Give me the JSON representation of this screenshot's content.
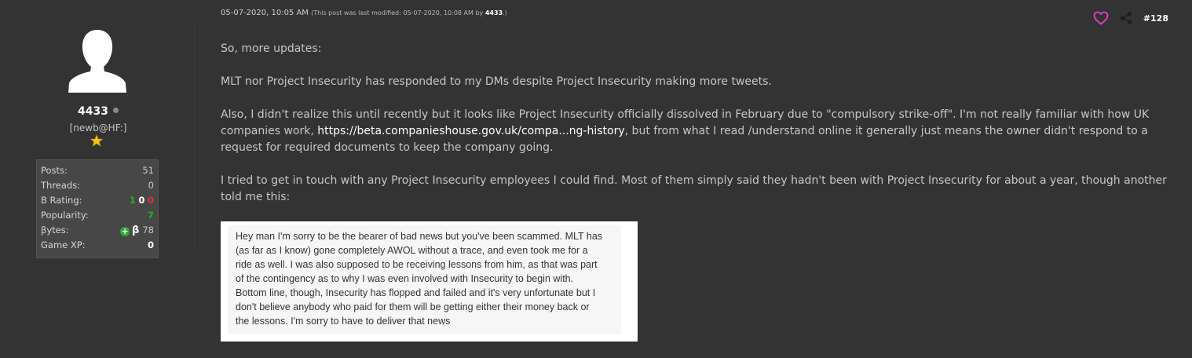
{
  "user": {
    "name": "4433",
    "title": "[newb@HF:]",
    "stats": [
      {
        "label": "Posts:",
        "value": "51"
      },
      {
        "label": "Threads:",
        "value": "0"
      },
      {
        "label": "B Rating:",
        "values": [
          "1",
          "0",
          "0"
        ]
      },
      {
        "label": "Popularity:",
        "value": "7"
      },
      {
        "label": "βytes:",
        "value": "78",
        "symbol": "β"
      },
      {
        "label": "Game XP:",
        "value": "0"
      }
    ]
  },
  "post": {
    "date": "05-07-2020, 10:05 AM",
    "modified_prefix": "(This post was last modified: 05-07-2020, 10:08 AM by ",
    "modified_by": "4433",
    "modified_suffix": ".)",
    "number": "#128",
    "paragraphs": [
      "So, more updates:",
      "MLT nor Project Insecurity has responded to my DMs despite Project Insecurity making more tweets."
    ],
    "p3_before": "Also, I didn't realize this until recently but it looks like Project Insecurity officially dissolved in February due to \"compulsory strike-off\". I'm not really familiar with how UK companies work, ",
    "p3_link": "https://beta.companieshouse.gov.uk/compa...ng-history",
    "p3_after": ", but from what I read /understand online it generally just means the owner didn't respond to a request for required documents to keep the company going.",
    "p4": "I tried to get in touch with any Project Insecurity employees I could find. Most of them simply said they hadn't been with Project Insecurity for about a year, though another told me this:",
    "quote_lines": [
      "Hey man I'm sorry to be the bearer of bad news but you've been scammed. MLT has",
      "(as far as I know) gone completely AWOL without a trace, and even took me for a",
      "ride as well. I was also supposed to be receiving lessons from him, as that was part",
      "of the contingency as to why I was even involved with Insecurity to begin with.",
      "Bottom line, though, Insecurity has flopped and failed and it's very unfortunate but I",
      "don't believe anybody who paid for them will be getting either their money back or",
      "the lessons. I'm sorry to have to deliver that news"
    ]
  },
  "colors": {
    "background": "#333333",
    "positive": "#21b11c",
    "negative": "#e43030",
    "like": "#e040c0"
  }
}
